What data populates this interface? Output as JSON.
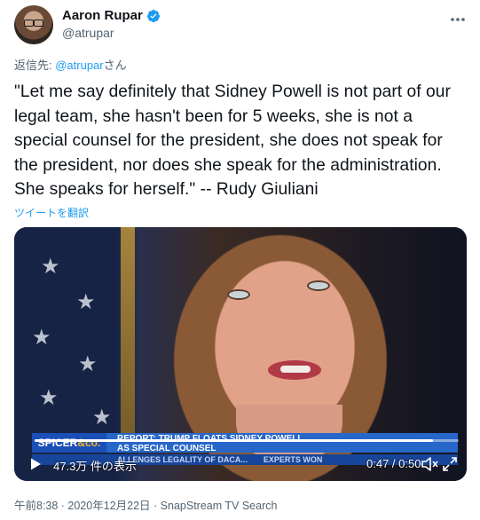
{
  "author": {
    "display_name": "Aaron Rupar",
    "handle": "@atrupar"
  },
  "reply": {
    "prefix": "返信先: ",
    "mention": "@atrupar",
    "suffix": "さん"
  },
  "tweet": {
    "text": "\"Let me say definitely that Sidney Powell is not part of our legal team, she hasn't been for 5 weeks, she is not a special counsel for the president, she does not speak for the president, nor does she speak for the administration. She speaks for herself.\" -- Rudy Giuliani",
    "translate_label": "ツイートを翻訳"
  },
  "video": {
    "lower_third_logo_main": "SPICER",
    "lower_third_logo_amp": "&co.",
    "lower_third_line1": "REPORT: TRUMP FLOATS SIDNEY POWELL",
    "lower_third_line2": "AS SPECIAL COUNSEL",
    "ticker_items": [
      "ALLENGES LEGALITY OF DACA...",
      "EXPERTS WON"
    ],
    "views": "47.3万 件の表示",
    "time": "0:47 / 0:50",
    "progress_fraction": 0.94
  },
  "meta": {
    "timestamp": "午前8:38 · 2020年12月22日 · SnapStream TV Search"
  },
  "colors": {
    "accent": "#1d9bf0",
    "text": "#0f1419",
    "secondary": "#536471"
  },
  "icons": [
    "verified-badge-icon",
    "more-options-icon",
    "play-icon",
    "volume-muted-icon",
    "fullscreen-icon"
  ]
}
